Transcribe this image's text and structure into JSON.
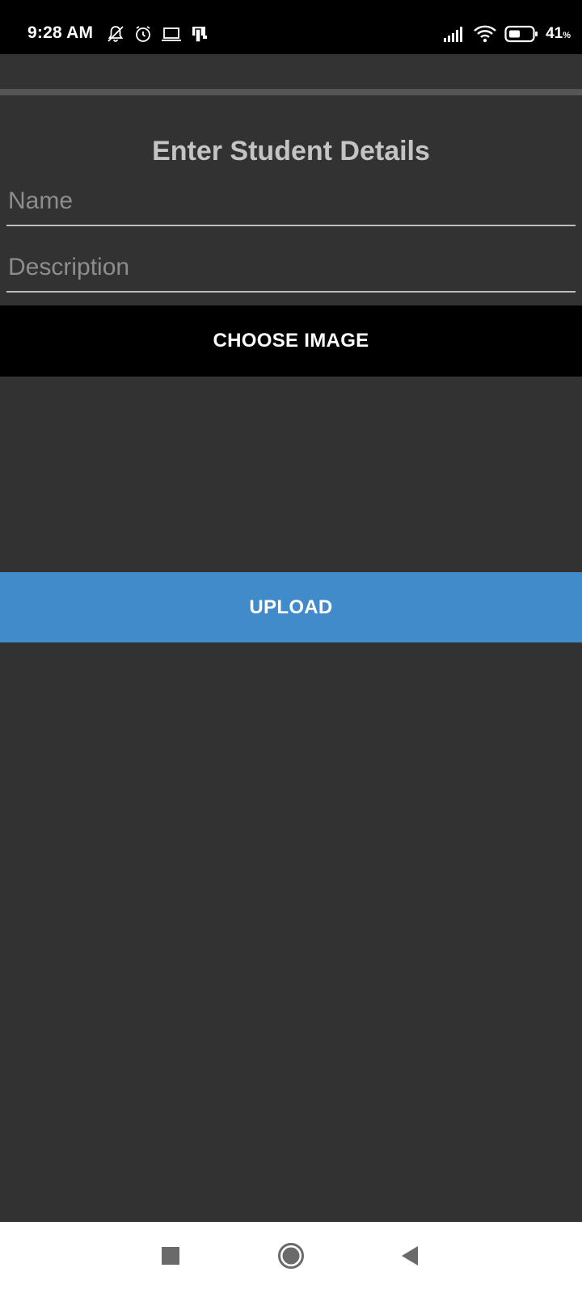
{
  "status_bar": {
    "time": "9:28 AM",
    "icons_left": [
      "bell-off-icon",
      "alarm-icon",
      "laptop-icon",
      "cast-icon"
    ],
    "icons_right": [
      "signal-icon",
      "wifi-icon",
      "battery-icon"
    ],
    "battery_percent": "41",
    "battery_unit": "%"
  },
  "form": {
    "title": "Enter Student Details",
    "name_placeholder": "Name",
    "name_value": "",
    "description_placeholder": "Description",
    "description_value": "",
    "choose_image_label": "CHOOSE IMAGE",
    "upload_label": "UPLOAD"
  },
  "nav_bar": {
    "items": [
      "recents-icon",
      "home-icon",
      "back-icon"
    ]
  },
  "colors": {
    "background": "#323232",
    "upload_button": "#418bcb",
    "choose_button": "#000000",
    "title_text": "#c4c4c4",
    "underline": "#bdbdbd"
  }
}
